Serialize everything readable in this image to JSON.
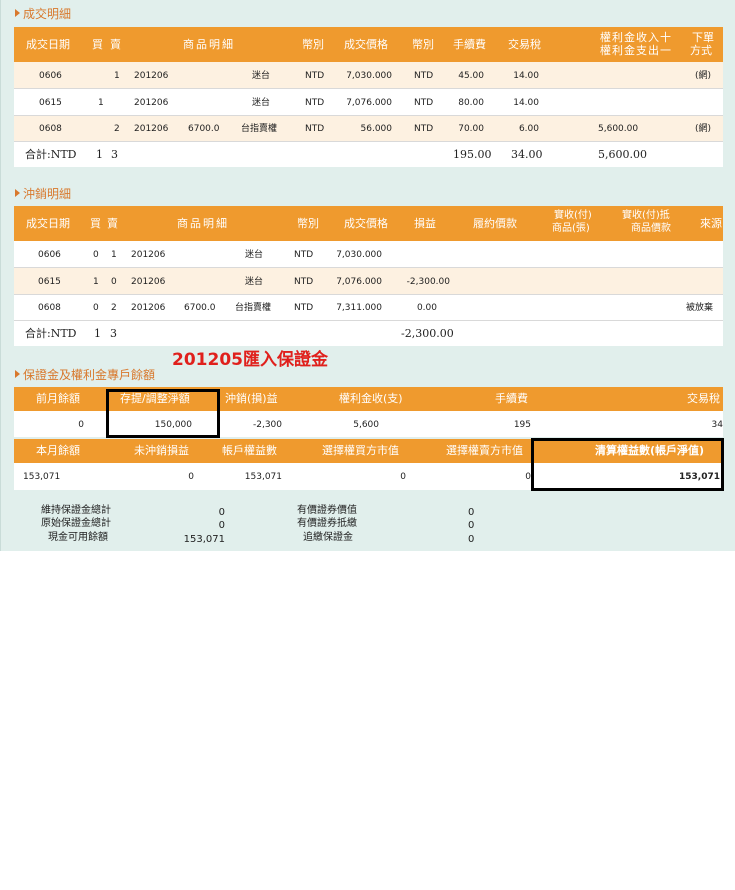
{
  "trade": {
    "title": "成交明細",
    "headers": {
      "date": "成交日期",
      "buy": "買",
      "sell": "賣",
      "detail": "商品明細",
      "currency": "幣別",
      "price": "成交價格",
      "cur2": "幣別",
      "fee": "手續費",
      "tax": "交易稅",
      "premium_l1": "權利金收入十",
      "premium_l2": "權利金支出一",
      "order_l1": "下單",
      "order_l2": "方式"
    },
    "rows": [
      {
        "date": "0606",
        "buy": "",
        "sell": "1",
        "month": "201206",
        "strike": "",
        "name": "迷台",
        "cur": "NTD",
        "price": "7,030.000",
        "cur2": "NTD",
        "fee": "45.00",
        "tax": "14.00",
        "premium": "",
        "method": "(網)"
      },
      {
        "date": "0615",
        "buy": "1",
        "sell": "",
        "month": "201206",
        "strike": "",
        "name": "迷台",
        "cur": "NTD",
        "price": "7,076.000",
        "cur2": "NTD",
        "fee": "80.00",
        "tax": "14.00",
        "premium": "",
        "method": ""
      },
      {
        "date": "0608",
        "buy": "",
        "sell": "2",
        "month": "201206",
        "strike": "6700.0",
        "name": "台指賣權",
        "cur": "NTD",
        "price": "56.000",
        "cur2": "NTD",
        "fee": "70.00",
        "tax": "6.00",
        "premium": "5,600.00",
        "method": "(網)"
      }
    ],
    "total": {
      "label": "合計:NTD",
      "buy": "1",
      "sell": "3",
      "fee": "195.00",
      "tax": "34.00",
      "premium": "5,600.00"
    }
  },
  "offset": {
    "title": "沖銷明細",
    "headers": {
      "date": "成交日期",
      "buy": "買",
      "sell": "賣",
      "detail": "商品明細",
      "currency": "幣別",
      "price": "成交價格",
      "pl": "損益",
      "strike_price": "履約價款",
      "recv_l1": "實收(付)",
      "recv_l2": "商品(張)",
      "recv2_l1": "實收(付)抵",
      "recv2_l2": "商品價款",
      "source": "來源"
    },
    "rows": [
      {
        "date": "0606",
        "buy": "0",
        "sell": "1",
        "month": "201206",
        "strike": "",
        "name": "迷台",
        "cur": "NTD",
        "price": "7,030.000",
        "pl": "",
        "source": ""
      },
      {
        "date": "0615",
        "buy": "1",
        "sell": "0",
        "month": "201206",
        "strike": "",
        "name": "迷台",
        "cur": "NTD",
        "price": "7,076.000",
        "pl": "-2,300.00",
        "source": ""
      },
      {
        "date": "0608",
        "buy": "0",
        "sell": "2",
        "month": "201206",
        "strike": "6700.0",
        "name": "台指賣權",
        "cur": "NTD",
        "price": "7,311.000",
        "pl": "0.00",
        "source": "被放棄"
      }
    ],
    "total": {
      "label": "合計:NTD",
      "buy": "1",
      "sell": "3",
      "pl": "-2,300.00"
    }
  },
  "margin": {
    "title": "保證金及權利金專戶餘額",
    "annotation": "201205匯入保證金",
    "h1": {
      "prev": "前月餘額",
      "deposit": "存提/調整淨額",
      "pl": "沖銷(損)益",
      "premium": "權利金收(支)",
      "fee": "手續費",
      "tax": "交易稅"
    },
    "v1": {
      "prev": "0",
      "deposit": "150,000",
      "pl": "-2,300",
      "premium": "5,600",
      "fee": "195",
      "tax": "34"
    },
    "h2": {
      "bal": "本月餘額",
      "unreal": "未沖銷損益",
      "equity": "帳戶權益數",
      "buy_mv": "選擇權買方市值",
      "sell_mv": "選擇權賣方市值",
      "net": "清算權益數(帳戶淨值)"
    },
    "v2": {
      "bal": "153,071",
      "unreal": "0",
      "equity": "153,071",
      "buy_mv": "0",
      "sell_mv": "0",
      "net": "153,071"
    }
  },
  "footer": [
    {
      "label": "維持保證金總計",
      "value": "0",
      "label2": "有價證券價值",
      "value2": "0"
    },
    {
      "label": "原始保證金總計",
      "value": "0",
      "label2": "有價證券抵繳",
      "value2": "0"
    },
    {
      "label": "現金可用餘額",
      "value": "153,071",
      "label2": "追繳保證金",
      "value2": "0"
    }
  ],
  "colors": {
    "header_orange": "#ef9a2e",
    "title_orange": "#d8782c",
    "panel": "#e1efec",
    "stripe": "#fdf1e1",
    "annotation_red": "#e0201c"
  }
}
